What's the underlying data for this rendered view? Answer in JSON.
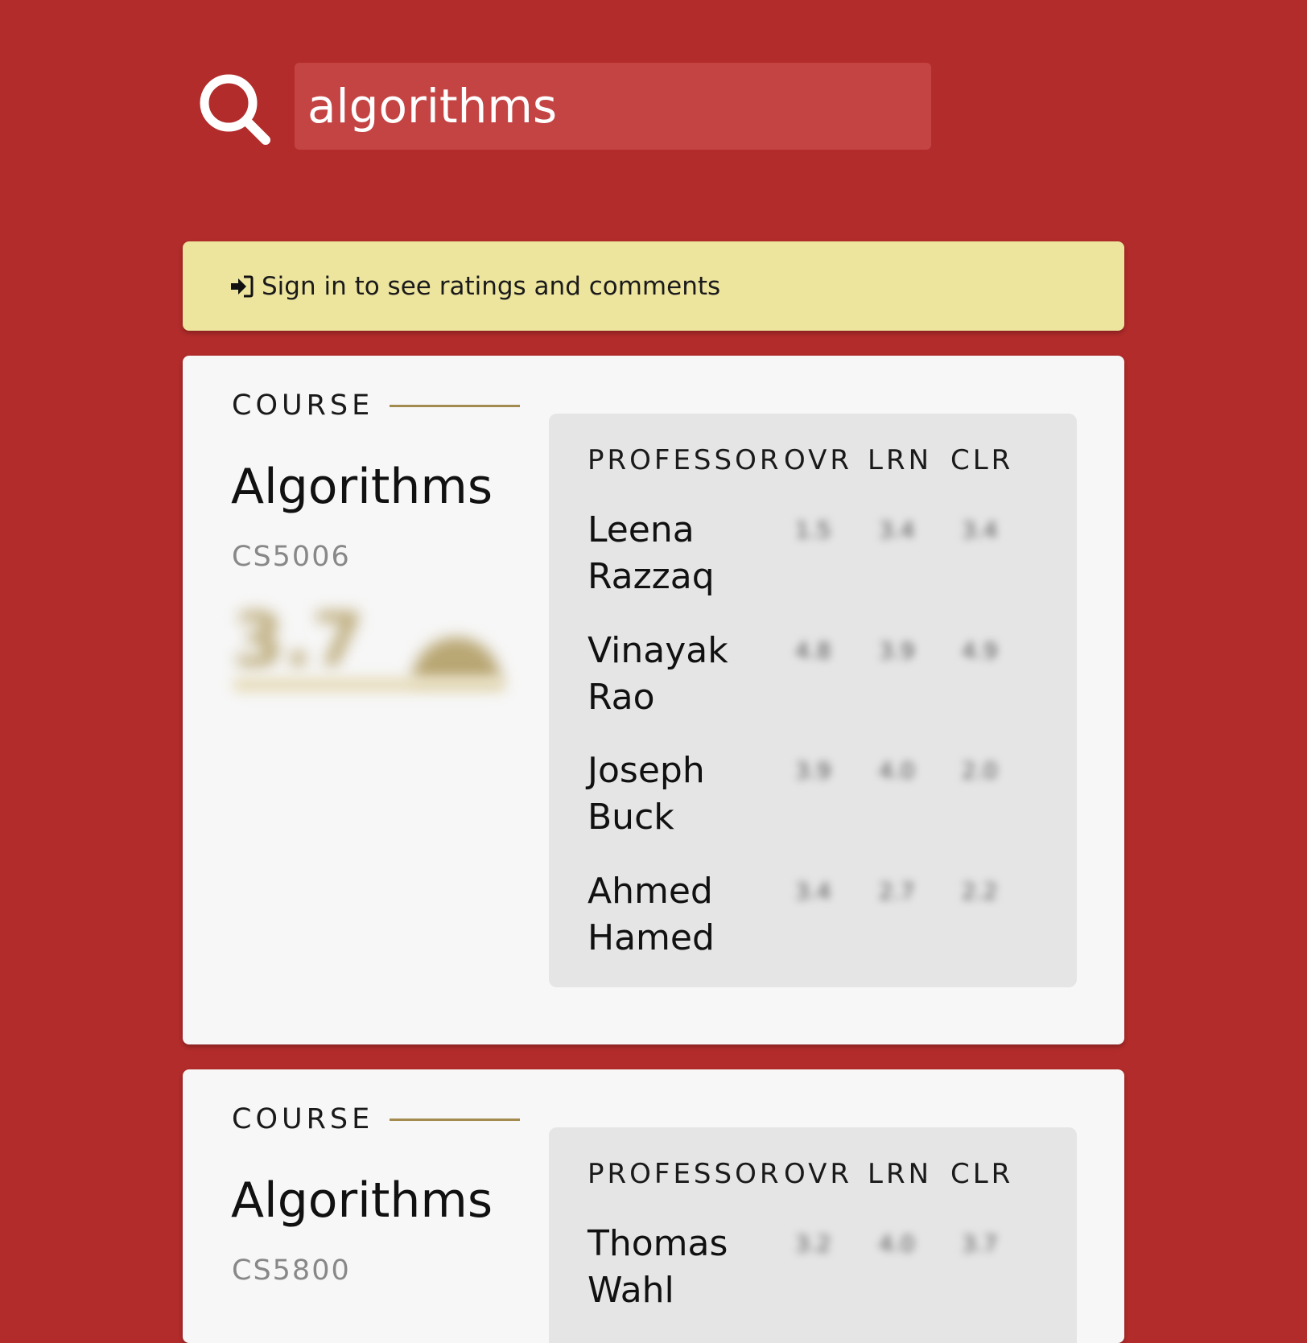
{
  "search": {
    "icon": "search-icon",
    "query": "algorithms"
  },
  "banner": {
    "icon": "sign-in-icon",
    "text": "Sign in to see ratings and comments",
    "color": "#ede49d"
  },
  "theme": {
    "background": "#b22c2b",
    "accent": "#a38b50"
  },
  "columns": {
    "professor": "PROFESSOR",
    "ovr": "OVR",
    "lrn": "LRN",
    "clr": "CLR"
  },
  "courses": [
    {
      "label": "COURSE",
      "title": "Algorithms",
      "code": "CS5006",
      "overall_score": "3.7",
      "professors": [
        {
          "name": "Leena Razzaq",
          "ovr": "1.5",
          "lrn": "3.4",
          "clr": "3.4"
        },
        {
          "name": "Vinayak Rao",
          "ovr": "4.8",
          "lrn": "3.9",
          "clr": "4.9"
        },
        {
          "name": "Joseph Buck",
          "ovr": "3.9",
          "lrn": "4.0",
          "clr": "2.0"
        },
        {
          "name": "Ahmed Hamed",
          "ovr": "3.4",
          "lrn": "2.7",
          "clr": "2.2"
        }
      ]
    },
    {
      "label": "COURSE",
      "title": "Algorithms",
      "code": "CS5800",
      "professors": [
        {
          "name": "Thomas Wahl",
          "ovr": "3.2",
          "lrn": "4.0",
          "clr": "3.7"
        }
      ]
    }
  ]
}
